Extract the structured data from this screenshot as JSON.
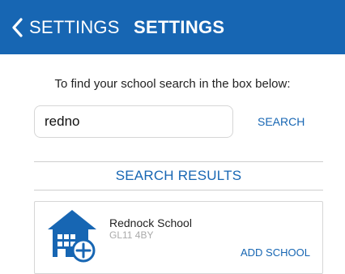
{
  "header": {
    "back_label": "SETTINGS",
    "title": "SETTINGS",
    "background_color": "#1766b3"
  },
  "search": {
    "instruction": "To find your school search in the box below:",
    "value": "redno",
    "button_label": "SEARCH"
  },
  "results": {
    "heading": "SEARCH RESULTS",
    "items": [
      {
        "name": "Rednock School",
        "postcode": "GL11 4BY",
        "icon": "school-add-icon",
        "action_label": "ADD SCHOOL"
      }
    ]
  },
  "colors": {
    "accent": "#1766b3"
  }
}
